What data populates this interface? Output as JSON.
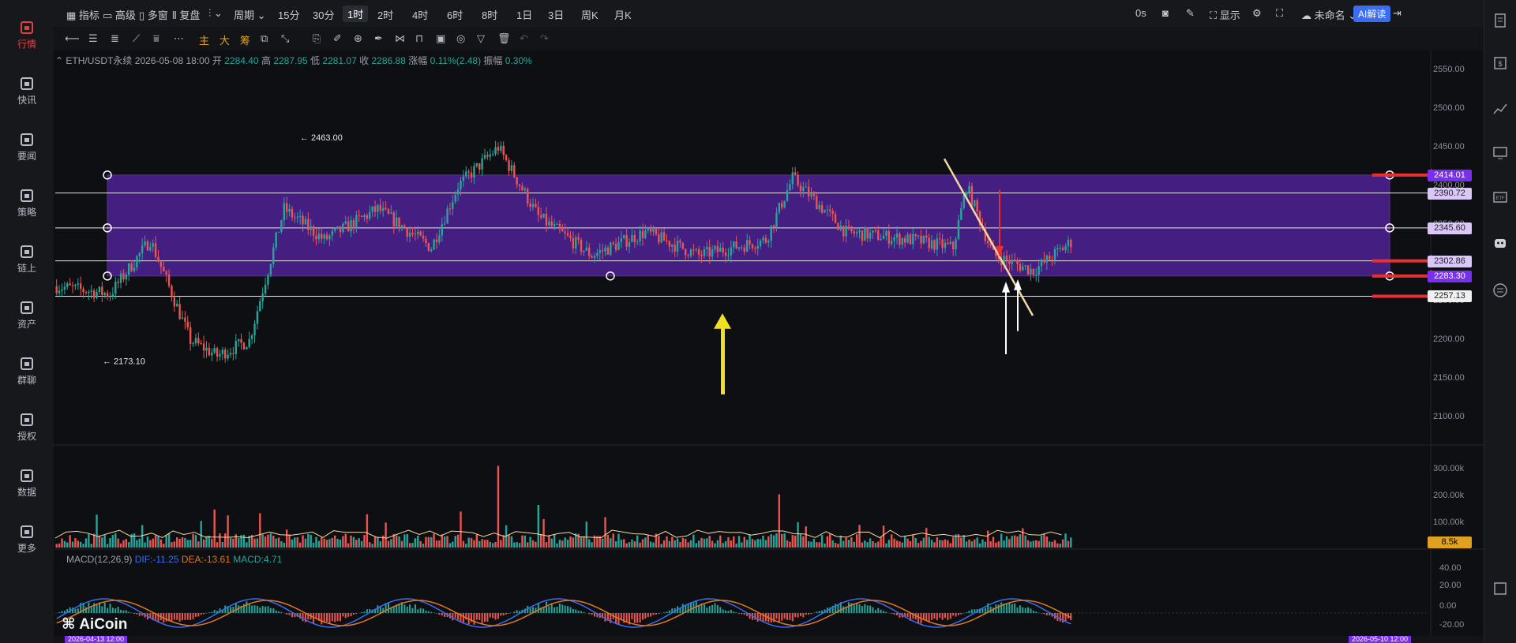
{
  "topbar": {
    "indicators": "指标",
    "advanced": "高级",
    "multi_window": "多窗",
    "replay": "复盘",
    "period": "周期",
    "intervals": [
      "15分",
      "30分",
      "1时",
      "2时",
      "4时",
      "6时",
      "8时",
      "1日",
      "3日",
      "周K",
      "月K"
    ],
    "selected_interval": "1时",
    "timer": "0s",
    "display": "显示",
    "layout_name": "未命名",
    "ai_button": "AI解读"
  },
  "toolbar": {
    "main": "主",
    "big": "大",
    "chips": "筹"
  },
  "sidebar": {
    "items": [
      {
        "label": "行情",
        "icon": "chart-bar-icon"
      },
      {
        "label": "快讯",
        "icon": "flash-news-icon"
      },
      {
        "label": "要闻",
        "icon": "news-icon"
      },
      {
        "label": "策略",
        "icon": "robot-icon"
      },
      {
        "label": "链上",
        "icon": "chain-icon"
      },
      {
        "label": "资产",
        "icon": "wallet-icon"
      },
      {
        "label": "群聊",
        "icon": "chat-icon"
      },
      {
        "label": "授权",
        "icon": "key-icon"
      },
      {
        "label": "数据",
        "icon": "data-icon"
      },
      {
        "label": "更多",
        "icon": "grid-icon"
      }
    ]
  },
  "info": {
    "symbol": "ETH/USDT永续",
    "datetime": "2026-05-08 18:00",
    "open_label": "开",
    "open": "2284.40",
    "high_label": "高",
    "high": "2287.95",
    "low_label": "低",
    "low": "2281.07",
    "close_label": "收",
    "close": "2286.88",
    "change_label": "涨幅",
    "change": "0.11%(2.48)",
    "amplitude_label": "振幅",
    "amplitude": "0.30%"
  },
  "annotations": {
    "high_marker": "← 2463.00",
    "low_marker": "← 2173.10"
  },
  "price_axis": [
    "2550.00",
    "2500.00",
    "2450.00",
    "2400.00",
    "2350.00",
    "2300.00",
    "2250.00",
    "2200.00",
    "2150.00",
    "2100.00"
  ],
  "price_labels": [
    {
      "text": "2414.01",
      "style": "pur"
    },
    {
      "text": "2390.72",
      "style": "lav"
    },
    {
      "text": "2345.60",
      "style": "lav"
    },
    {
      "text": "2302.86",
      "style": "lav"
    },
    {
      "text": "2283.30",
      "style": "pur"
    },
    {
      "text": "2257.13",
      "style": "wht"
    }
  ],
  "volume_axis": [
    "300.00k",
    "200.00k",
    "100.00k"
  ],
  "volume_current": "8.5k",
  "macd": {
    "name": "MACD(12,26,9)",
    "dif": "DIF:-11.25",
    "dea": "DEA:-13.61",
    "macd": "MACD:4.71"
  },
  "macd_axis": [
    "40.00",
    "20.00",
    "0.00",
    "-20.00"
  ],
  "watermark": "AiCoin",
  "time_start": "2026-04-13 12:00",
  "time_end": "2026-05-10 12:00",
  "colors": {
    "up": "#26a69a",
    "down": "#ef5350",
    "band": "#7a2ff0",
    "arrow_red": "#e83030",
    "arrow_yellow": "#f0e020",
    "trend": "#f2d9a0"
  }
}
